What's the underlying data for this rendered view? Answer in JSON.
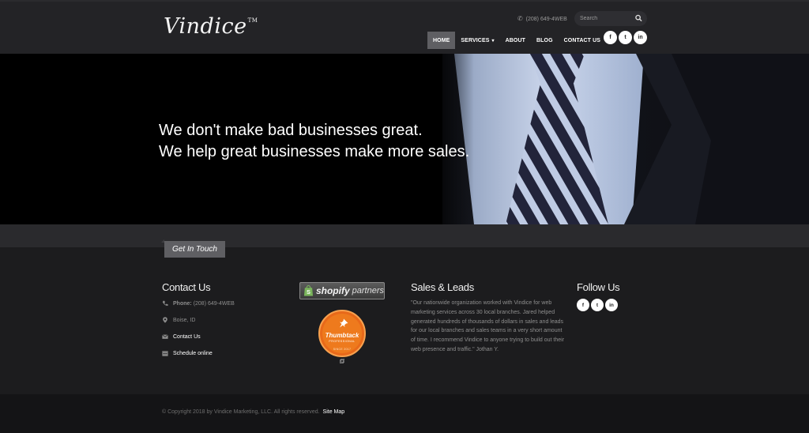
{
  "header": {
    "logo_text": "Vindice",
    "logo_tm": "TM",
    "phone": "(208) 649-4WEB",
    "search_placeholder": "Search"
  },
  "nav": {
    "items": [
      {
        "label": "HOME",
        "active": true
      },
      {
        "label": "SERVICES",
        "has_dropdown": true
      },
      {
        "label": "ABOUT"
      },
      {
        "label": "BLOG"
      },
      {
        "label": "CONTACT US"
      }
    ],
    "social": [
      {
        "icon": "facebook-icon",
        "glyph": "f"
      },
      {
        "icon": "twitter-icon",
        "glyph": "t"
      },
      {
        "icon": "linkedin-icon",
        "glyph": "in"
      }
    ]
  },
  "hero": {
    "line1": "We don't make bad businesses great.",
    "line2": "We help great businesses make more sales."
  },
  "section_tab": "Get In Touch",
  "contact": {
    "title": "Contact Us",
    "phone_label": "Phone:",
    "phone_value": "(208) 649-4WEB",
    "location": "Boise, ID",
    "contact_link": "Contact Us",
    "schedule_link": "Schedule online"
  },
  "badges": {
    "shopify_word": "shopify",
    "shopify_partners": "partners",
    "thumbtack_name": "Thumbtack",
    "thumbtack_pro": "PROFESSIONAL",
    "thumbtack_since": "SINCE 2017"
  },
  "sales": {
    "title": "Sales & Leads",
    "quote": "\"Our nationwide organization worked with Vindice for web marketing services across 30 local branches. Jared helped generated hundreds of thousands of dollars in sales and leads for our local branches and sales teams in a very short amount of time. I recommend Vindice to anyone trying to build out their web presence and traffic.\" Jothan Y."
  },
  "follow": {
    "title": "Follow Us"
  },
  "footer": {
    "copyright": "© Copyright 2018 by Vindice Marketing, LLC. All rights reserved.",
    "sitemap": "Site Map"
  },
  "colors": {
    "header_bg": "#232326",
    "nav_active": "#5f5f63",
    "body_bg": "#1c1c1e",
    "thumbtack_orange": "#ee7a1d",
    "shopify_green": "#7ab55c"
  }
}
